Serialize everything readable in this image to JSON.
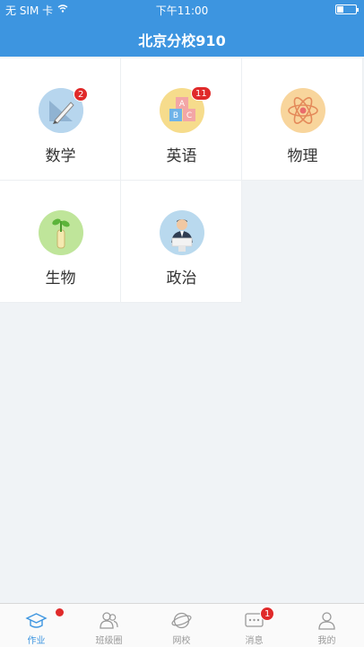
{
  "status_bar": {
    "carrier": "无 SIM 卡",
    "time": "下午11:00"
  },
  "header": {
    "title": "北京分校910"
  },
  "subjects": [
    {
      "label": "数学",
      "badge": "2"
    },
    {
      "label": "英语",
      "badge": "11"
    },
    {
      "label": "物理",
      "badge": ""
    },
    {
      "label": "生物",
      "badge": ""
    },
    {
      "label": "政治",
      "badge": ""
    }
  ],
  "tabbar": {
    "items": [
      {
        "label": "作业"
      },
      {
        "label": "班级圈"
      },
      {
        "label": "网校"
      },
      {
        "label": "消息",
        "badge": "1"
      },
      {
        "label": "我的"
      }
    ]
  },
  "colors": {
    "accent": "#3d95e0",
    "badge": "#e02a2a",
    "background": "#f0f3f6"
  }
}
